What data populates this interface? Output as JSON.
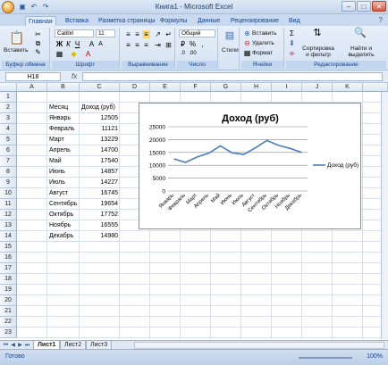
{
  "window": {
    "title": "Книга1 - Microsoft Excel"
  },
  "tabs": [
    "Главная",
    "Вставка",
    "Разметка страницы",
    "Формулы",
    "Данные",
    "Рецензирование",
    "Вид"
  ],
  "ribbon": {
    "clipboard": {
      "paste": "Вставить",
      "label": "Буфер обмена"
    },
    "font": {
      "name": "Calibri",
      "size": "11",
      "label": "Шрифт"
    },
    "alignment": {
      "label": "Выравнивание"
    },
    "number": {
      "format": "Общий",
      "label": "Число"
    },
    "styles": {
      "button": "Стили"
    },
    "cells": {
      "insert": "Вставить",
      "delete": "Удалить",
      "format": "Формат",
      "label": "Ячейки"
    },
    "editing": {
      "sort": "Сортировка и фильтр",
      "find": "Найти и выделить",
      "label": "Редактирование"
    }
  },
  "formula_bar": {
    "name_box": "H18",
    "fx": "fx",
    "value": ""
  },
  "columns": [
    "A",
    "B",
    "C",
    "D",
    "E",
    "F",
    "G",
    "H",
    "I",
    "J",
    "K"
  ],
  "rows": [
    "1",
    "2",
    "3",
    "4",
    "5",
    "6",
    "7",
    "8",
    "9",
    "10",
    "11",
    "12",
    "13",
    "14",
    "15",
    "16",
    "17",
    "18",
    "19",
    "20",
    "21",
    "22",
    "23"
  ],
  "table": {
    "header": {
      "month": "Месяц",
      "income": "Доход (руб)"
    },
    "rows": [
      {
        "month": "Январь",
        "income": "12505"
      },
      {
        "month": "Февраль",
        "income": "11121"
      },
      {
        "month": "Март",
        "income": "13229"
      },
      {
        "month": "Апрель",
        "income": "14700"
      },
      {
        "month": "Май",
        "income": "17540"
      },
      {
        "month": "Июнь",
        "income": "14857"
      },
      {
        "month": "Июль",
        "income": "14227"
      },
      {
        "month": "Август",
        "income": "16745"
      },
      {
        "month": "Сентябрь",
        "income": "19654"
      },
      {
        "month": "Октябрь",
        "income": "17752"
      },
      {
        "month": "Ноябрь",
        "income": "16555"
      },
      {
        "month": "Декабрь",
        "income": "14980"
      }
    ]
  },
  "chart_data": {
    "type": "line",
    "title": "Доход (руб)",
    "categories": [
      "Январь",
      "Февраль",
      "Март",
      "Апрель",
      "Май",
      "Июнь",
      "Июль",
      "Август",
      "Сентябрь",
      "Октябрь",
      "Ноябрь",
      "Декабрь"
    ],
    "series": [
      {
        "name": "Доход (руб)",
        "values": [
          12505,
          11121,
          13229,
          14700,
          17540,
          14857,
          14227,
          16745,
          19654,
          17752,
          16555,
          14980
        ],
        "color": "#4a7ebb"
      }
    ],
    "ylim": [
      0,
      25000
    ],
    "yticks": [
      "0",
      "5000",
      "10000",
      "15000",
      "20000",
      "25000"
    ],
    "grid": true,
    "legend": "right"
  },
  "sheets": [
    "Лист1",
    "Лист2",
    "Лист3"
  ],
  "status": {
    "text": "Готово",
    "zoom": "100%"
  }
}
